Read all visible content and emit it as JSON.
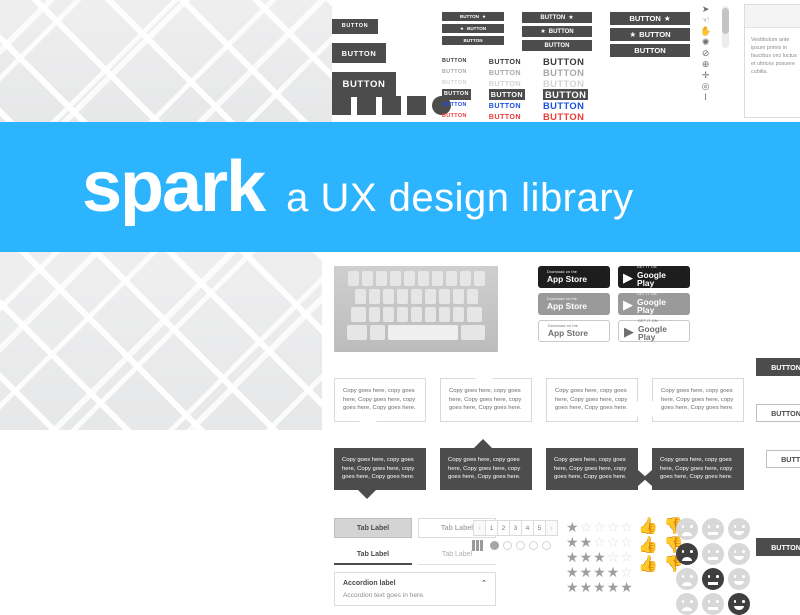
{
  "banner": {
    "brand": "spark",
    "tagline": "a UX design library",
    "accent_color": "#2db4ff"
  },
  "solid_buttons": {
    "labels": [
      "BUTTON",
      "BUTTON",
      "BUTTON"
    ],
    "swatch_count": 5
  },
  "star_buttons": {
    "sizes": [
      "small",
      "medium",
      "large"
    ],
    "rows": [
      {
        "label": "BUTTON",
        "icon": "star-icon",
        "icon_side": "right"
      },
      {
        "label": "BUTTON",
        "icon": "star-icon",
        "icon_side": "left"
      },
      {
        "label": "BUTTON",
        "icon": "none",
        "icon_side": "none"
      }
    ],
    "star_glyph": "★"
  },
  "text_buttons": {
    "label": "BUTTON",
    "states": [
      "default",
      "hover",
      "disabled",
      "inverted",
      "link",
      "danger"
    ],
    "state_colors": [
      "#3b3b3b",
      "#a8a8a8",
      "#d3d3d3",
      "#ffffff",
      "#1a4fe0",
      "#ec3b3b"
    ]
  },
  "cursors": {
    "icons": [
      "pointer-icon",
      "hand-icon",
      "grab-icon",
      "help-icon",
      "no-entry-icon",
      "zoom-in-icon",
      "move-icon",
      "crosshair-icon",
      "text-cursor-icon"
    ],
    "glyphs": [
      "➤",
      "☜",
      "✋",
      "✺",
      "⊘",
      "⊕",
      "✛",
      "◎",
      "I"
    ]
  },
  "panel": {
    "body_text": "Vestibulum ante ipsum primis in faucibus orci luctus et ultrices posuere cubilia."
  },
  "keyboard": {
    "name": "on-screen-keyboard",
    "rows": [
      10,
      9,
      9,
      5
    ]
  },
  "store_badges": {
    "rows": [
      {
        "style": "dark",
        "apple": {
          "small": "Download on the",
          "big": "App Store"
        },
        "google": {
          "small": "GET IT ON",
          "big": "Google Play"
        }
      },
      {
        "style": "grey",
        "apple": {
          "small": "Download on the",
          "big": "App Store"
        },
        "google": {
          "small": "GET IT ON",
          "big": "Google Play"
        }
      },
      {
        "style": "outline",
        "apple": {
          "small": "Download on the",
          "big": "App Store"
        },
        "google": {
          "small": "GET IT ON",
          "big": "Google Play"
        }
      }
    ],
    "apple_glyph": "",
    "google_glyph": "▶"
  },
  "tooltips": {
    "copy": "Copy goes here, copy goes here, Copy goes here, copy goes here, Copy goes here.",
    "light_arrows": [
      "down",
      "up",
      "right",
      "left"
    ],
    "dark_arrows": [
      "down",
      "up",
      "right",
      "left"
    ]
  },
  "tabs": {
    "boxed": [
      {
        "label": "Tab Label",
        "active": true
      },
      {
        "label": "Tab Label",
        "active": false
      }
    ],
    "underline": [
      {
        "label": "Tab Label",
        "active": true
      },
      {
        "label": "Tab Label",
        "active": false
      }
    ]
  },
  "accordion": {
    "label": "Accordion label",
    "body": "Accordion text goes in here.",
    "chevron": "⌃"
  },
  "pagination": {
    "prev": "‹",
    "next": "›",
    "pages": [
      "1",
      "2",
      "3",
      "4",
      "5"
    ]
  },
  "carousel": {
    "bar_count": 3,
    "dots": 5,
    "active_dot": 0
  },
  "ratings": {
    "star_filled": "★",
    "star_empty": "☆",
    "rows": [
      1,
      2,
      3,
      4,
      5
    ],
    "max": 5
  },
  "thumbs": {
    "up_glyph": "👍",
    "down_glyph": "👎",
    "rows": [
      "light",
      "medium",
      "dark"
    ]
  },
  "faces": {
    "columns": [
      "sad",
      "neutral",
      "happy"
    ],
    "rows": 4
  },
  "side_buttons": [
    {
      "label": "BUTTON",
      "style": "solid"
    },
    {
      "label": "BUTTON",
      "style": "outline"
    },
    {
      "label": "BUTTON",
      "style": "outline"
    },
    {
      "label": "BUTTON",
      "style": "solid"
    }
  ]
}
